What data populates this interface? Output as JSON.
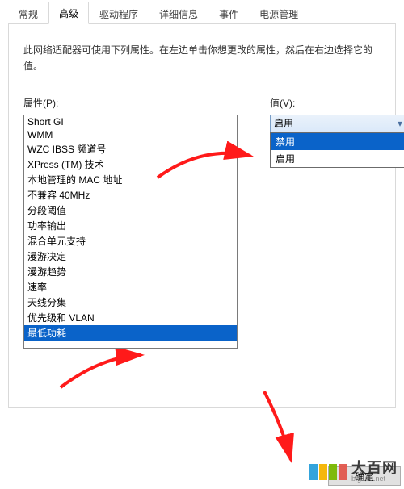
{
  "tabs": {
    "items": [
      {
        "label": "常规",
        "active": false
      },
      {
        "label": "高级",
        "active": true
      },
      {
        "label": "驱动程序",
        "active": false
      },
      {
        "label": "详细信息",
        "active": false
      },
      {
        "label": "事件",
        "active": false
      },
      {
        "label": "电源管理",
        "active": false
      }
    ]
  },
  "description": "此网络适配器可使用下列属性。在左边单击你想更改的属性，然后在右边选择它的值。",
  "property": {
    "label": "属性(P):",
    "items": [
      "Short GI",
      "WMM",
      "WZC IBSS 频道号",
      "XPress (TM) 技术",
      "本地管理的 MAC 地址",
      "不兼容 40MHz",
      "分段阈值",
      "功率输出",
      "混合单元支持",
      "漫游决定",
      "漫游趋势",
      "速率",
      "天线分集",
      "优先级和 VLAN",
      "最低功耗"
    ],
    "selected_index": 14
  },
  "value": {
    "label": "值(V):",
    "current": "启用",
    "options": [
      "禁用",
      "启用"
    ],
    "highlighted_index": 0
  },
  "buttons": {
    "ok": "确定"
  },
  "icons": {
    "chevron_down": "▾"
  },
  "watermark": {
    "cn": "大百网",
    "en": "big100.net"
  }
}
